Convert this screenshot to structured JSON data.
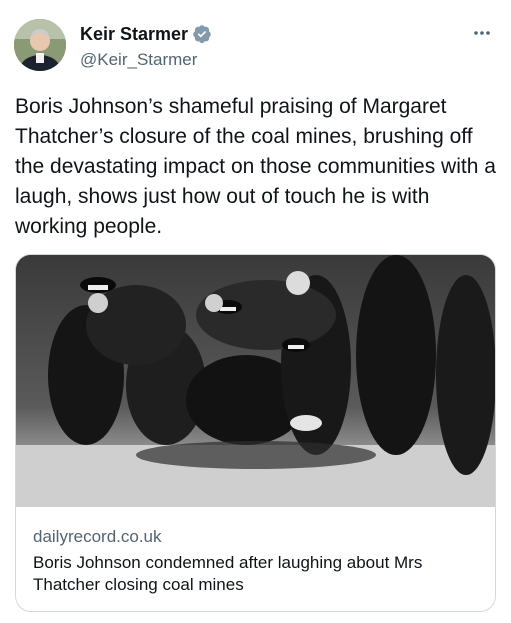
{
  "author": {
    "display_name": "Keir Starmer",
    "handle": "@Keir_Starmer",
    "verified": true,
    "verified_color": "#829aab",
    "avatar_icon": "profile-photo"
  },
  "more_icon": "ellipsis-icon",
  "tweet": {
    "text": "Boris Johnson’s shameful praising of Margaret Thatcher’s closure of the coal mines, brushing off the devastating impact on those communities with a laugh, shows just how out of touch he is with working people."
  },
  "link_card": {
    "domain": "dailyrecord.co.uk",
    "title": "Boris Johnson condemned after laughing about Mrs Thatcher closing coal mines",
    "image_description_icon": "news-photo"
  },
  "colors": {
    "text_primary": "#0f1419",
    "text_secondary": "#536471",
    "border": "#cfd9de"
  }
}
